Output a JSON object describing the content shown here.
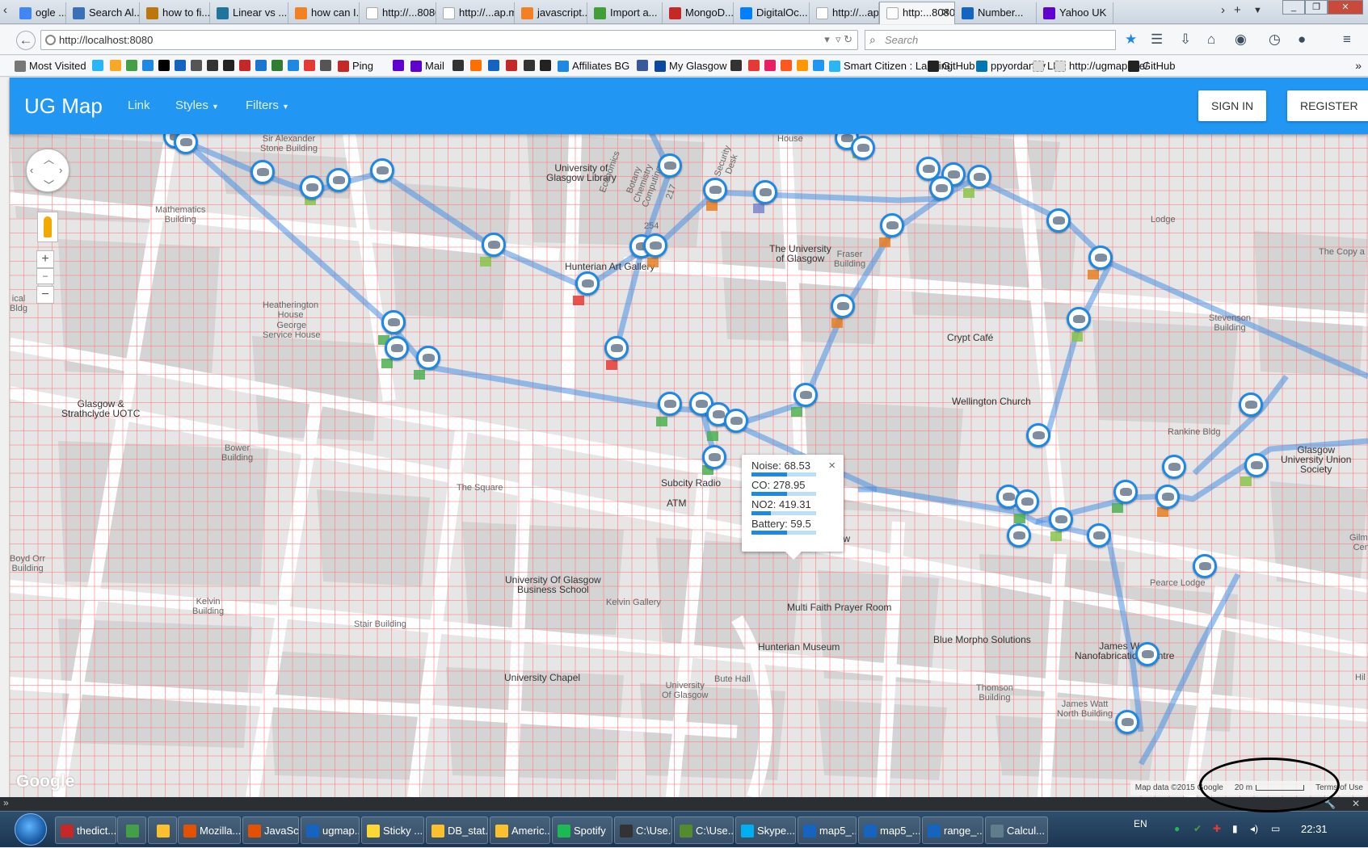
{
  "browser": {
    "tabs": [
      {
        "label": "ogle ...",
        "color": "#4285f4"
      },
      {
        "label": "Search Al...",
        "color": "#3b6fb6"
      },
      {
        "label": "how to fi...",
        "color": "#b9770e"
      },
      {
        "label": "Linear vs ...",
        "color": "#21759b"
      },
      {
        "label": "how can I...",
        "color": "#f48024"
      },
      {
        "label": "http://...8080/#",
        "color": ""
      },
      {
        "label": "http://...ap.me/",
        "color": ""
      },
      {
        "label": "javascript...",
        "color": "#f48024"
      },
      {
        "label": "Import a...",
        "color": "#3fa037"
      },
      {
        "label": "MongoD...",
        "color": "#c62828"
      },
      {
        "label": "DigitalOc...",
        "color": "#0080ff"
      },
      {
        "label": "http://...ap.me/",
        "color": ""
      },
      {
        "label": "http:...8080/",
        "color": "",
        "active": true
      },
      {
        "label": "Number...",
        "color": "#1565c0"
      },
      {
        "label": "Yahoo UK",
        "color": "#5f01d1"
      }
    ],
    "url": "http://localhost:8080",
    "search_placeholder": "Search",
    "bookmarks": [
      {
        "label": "Most Visited",
        "color": "#777"
      },
      {
        "label": "",
        "color": "#29b6f6"
      },
      {
        "label": "",
        "color": "#f9a825"
      },
      {
        "label": "",
        "color": "#43a047"
      },
      {
        "label": "",
        "color": "#1e88e5"
      },
      {
        "label": "",
        "color": "#000"
      },
      {
        "label": "",
        "color": "#1565c0"
      },
      {
        "label": "",
        "color": "#555"
      },
      {
        "label": "",
        "color": "#333"
      },
      {
        "label": "",
        "color": "#222"
      },
      {
        "label": "",
        "color": "#c62828"
      },
      {
        "label": "",
        "color": "#1976d2"
      },
      {
        "label": "",
        "color": "#2e7d32"
      },
      {
        "label": "",
        "color": "#1e88e5"
      },
      {
        "label": "",
        "color": "#e53935"
      },
      {
        "label": "",
        "color": "#555"
      },
      {
        "label": "Ping",
        "color": "#c62828"
      },
      {
        "label": "",
        "color": "#5f01d1"
      },
      {
        "label": "Mail",
        "color": "#5f01d1"
      },
      {
        "label": "",
        "color": "#333"
      },
      {
        "label": "",
        "color": "#ff6f00"
      },
      {
        "label": "",
        "color": "#1565c0"
      },
      {
        "label": "",
        "color": "#c62828"
      },
      {
        "label": "",
        "color": "#333"
      },
      {
        "label": "",
        "color": "#222"
      },
      {
        "label": "Affiliates BG",
        "color": "#1e88e5"
      },
      {
        "label": "",
        "color": "#3b5998"
      },
      {
        "label": "My Glasgow",
        "color": "#0d47a1"
      },
      {
        "label": "",
        "color": "#333"
      },
      {
        "label": "",
        "color": "#e53935"
      },
      {
        "label": "",
        "color": "#e91e63"
      },
      {
        "label": "",
        "color": "#ff5722"
      },
      {
        "label": "",
        "color": "#ff9800"
      },
      {
        "label": "",
        "color": "#2196f3"
      },
      {
        "label": "Smart Citizen : Landing",
        "color": "#29b6f6"
      },
      {
        "label": "GitHub",
        "color": "#222"
      },
      {
        "label": "ppyordanov",
        "color": "#0077b5"
      },
      {
        "label": "LH",
        "color": "#ddd"
      },
      {
        "label": "http://ugmap.me/",
        "color": "#ddd"
      },
      {
        "label": "GitHub",
        "color": "#222"
      }
    ]
  },
  "app": {
    "brand": "UG Map",
    "menu": [
      {
        "label": "Link"
      },
      {
        "label": "Styles",
        "dropdown": true
      },
      {
        "label": "Filters",
        "dropdown": true
      }
    ],
    "sign_in": "SIGN IN",
    "register": "REGISTER"
  },
  "popup": {
    "rows": [
      {
        "label": "Noise: 68.53",
        "fraction": 0.55
      },
      {
        "label": "CO: 278.95",
        "fraction": 0.55
      },
      {
        "label": "NO2: 419.31",
        "fraction": 0.3
      },
      {
        "label": "Battery: 59.5",
        "fraction": 0.55
      }
    ],
    "close": "×"
  },
  "map_labels": [
    {
      "text": "Sir Alexander\nStone Building"
    },
    {
      "text": "University of\nGlasgow Library",
      "dark": true
    },
    {
      "text": "Mathematics\nBuilding"
    },
    {
      "text": "Economics"
    },
    {
      "text": "Botany\nChemistry\nComputing"
    },
    {
      "text": "254"
    },
    {
      "text": "217"
    },
    {
      "text": "Security\nDesk"
    },
    {
      "text": "House"
    },
    {
      "text": "Lodge"
    },
    {
      "text": "The Copy a"
    },
    {
      "text": "Hunterian Art Gallery",
      "dark": true
    },
    {
      "text": "The University\nof Glasgow",
      "dark": true
    },
    {
      "text": "Fraser\nBuilding"
    },
    {
      "text": "Heatherington\nHouse"
    },
    {
      "text": "George\nService House"
    },
    {
      "text": "Crypt Café",
      "dark": true
    },
    {
      "text": "Stevenson\nBuilding"
    },
    {
      "text": "Wellington Church",
      "dark": true
    },
    {
      "text": "Glasgow &\nStrathclyde UOTC",
      "dark": true
    },
    {
      "text": "Rankine Bldg"
    },
    {
      "text": "Glasgow\nUniversity Union\nSociety",
      "dark": true
    },
    {
      "text": "Bower\nBuilding"
    },
    {
      "text": "The Square"
    },
    {
      "text": "Subcity Radio",
      "dark": true
    },
    {
      "text": "ATM",
      "dark": true
    },
    {
      "text": "University of Glasgow",
      "dark": true
    },
    {
      "text": "University Of Glasgow\nBusiness School",
      "dark": true
    },
    {
      "text": "Kelvin Gallery"
    },
    {
      "text": "Pearce Lodge"
    },
    {
      "text": "Kelvin\nBuilding"
    },
    {
      "text": "Multi Faith Prayer Room",
      "dark": true
    },
    {
      "text": "Stair Building"
    },
    {
      "text": "Blue Morpho Solutions",
      "dark": true
    },
    {
      "text": "Hunterian Museum",
      "dark": true
    },
    {
      "text": "James Watt\nNanofabrication Centre",
      "dark": true
    },
    {
      "text": "University Chapel",
      "dark": true
    },
    {
      "text": "Bute Hall"
    },
    {
      "text": "University\nOf Glasgow"
    },
    {
      "text": "Thomson\nBuilding"
    },
    {
      "text": "James Watt\nNorth Building"
    },
    {
      "text": "ical\nBldg"
    },
    {
      "text": "Gilmor\nCent"
    },
    {
      "text": "Hil"
    },
    {
      "text": "Boyd Orr\nBuilding"
    }
  ],
  "map_footer": {
    "google": "Google",
    "map_data": "Map data ©2015 Google",
    "scale": "20 m",
    "terms": "Terms of Use"
  },
  "taskbar": {
    "items": [
      {
        "label": "thedict...",
        "color": "#c62828"
      },
      {
        "label": "",
        "color": "#43a047"
      },
      {
        "label": "",
        "color": "#fbc02d"
      },
      {
        "label": "Mozilla...",
        "color": "#e65100"
      },
      {
        "label": "JavaScr...",
        "color": "#e65100"
      },
      {
        "label": "ugmap...",
        "color": "#1565c0"
      },
      {
        "label": "Sticky ...",
        "color": "#fdd835"
      },
      {
        "label": "DB_stat...",
        "color": "#fbc02d"
      },
      {
        "label": "Americ...",
        "color": "#fbc02d"
      },
      {
        "label": "Spotify",
        "color": "#1db954"
      },
      {
        "label": "C:\\Use...",
        "color": "#333"
      },
      {
        "label": "C:\\Use...",
        "color": "#558b2f"
      },
      {
        "label": "Skype...",
        "color": "#00aff0"
      },
      {
        "label": "map5_...",
        "color": "#1565c0"
      },
      {
        "label": "map5_...",
        "color": "#1565c0"
      },
      {
        "label": "range_...",
        "color": "#1565c0"
      },
      {
        "label": "Calcul...",
        "color": "#607d8b"
      }
    ],
    "lang": "EN",
    "clock": "22:31"
  }
}
